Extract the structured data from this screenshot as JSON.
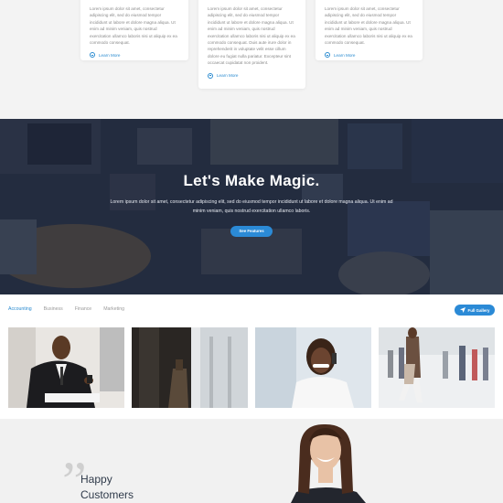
{
  "cards": [
    {
      "text": "Lorem ipsum dolor sit amet, consectetur adipiscing elit, sed do eiusmod tempor incididunt ut labore et dolore magna aliqua. Ut enim ad minim veniam, quis nostrud exercitation ullamco laboris nisi ut aliquip ex ea commodo consequat.",
      "link": "Learn More"
    },
    {
      "text": "Lorem ipsum dolor sit amet, consectetur adipiscing elit, sed do eiusmod tempor incididunt ut labore et dolore magna aliqua. Ut enim ad minim veniam, quis nostrud exercitation ullamco laboris nisi ut aliquip ex ea commodo consequat. Duis aute irure dolor in reprehenderit in voluptate velit esse cillum dolore eu fugiat nulla pariatur. Excepteur sint occaecat cupidatat non proident.",
      "link": "Learn More"
    },
    {
      "text": "Lorem ipsum dolor sit amet, consectetur adipiscing elit, sed do eiusmod tempor incididunt ut labore et dolore magna aliqua. Ut enim ad minim veniam, quis nostrud exercitation ullamco laboris nisi ut aliquip ex ea commodo consequat.",
      "link": "Learn More"
    }
  ],
  "hero": {
    "title": "Let's Make Magic.",
    "text": "Lorem ipsum dolor sit amet, consectetur adipiscing elit, sed do eiusmod tempor incididunt ut labore et dolore magna aliqua. Ut enim ad minim veniam, quis nostrud exercitation ullamco laboris.",
    "button": "See Features"
  },
  "gallery": {
    "tabs": [
      "Accounting",
      "Business",
      "Finance",
      "Marketing"
    ],
    "active_tab": "Accounting",
    "full_button": "Full Gallery"
  },
  "testimonials": {
    "quote_mark": "”",
    "heading_line1": "Happy",
    "heading_line2": "Customers"
  },
  "colors": {
    "accent": "#2b8ad6",
    "hero_overlay": "#1e263a",
    "heading": "#2f3a4a"
  }
}
